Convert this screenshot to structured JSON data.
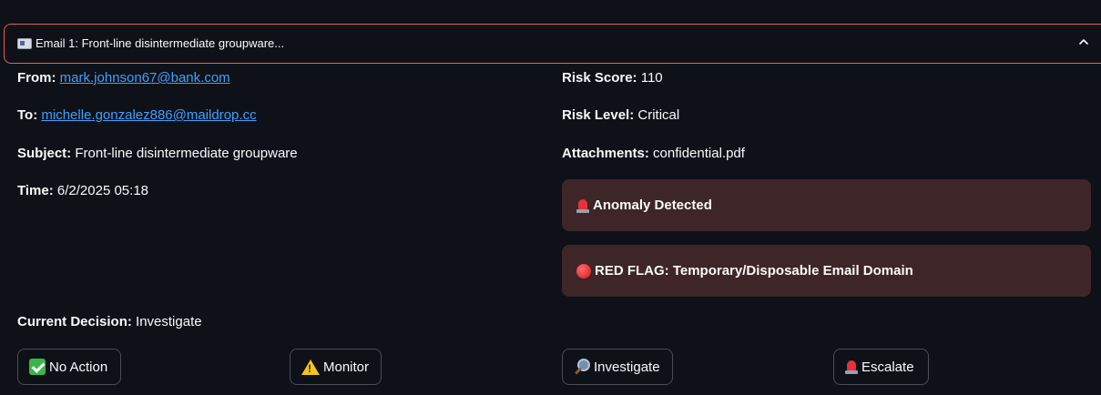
{
  "expander": {
    "title": "Email 1: Front-line disintermediate groupware...",
    "icon": "email-icon",
    "toggle_icon": "chevron-up-icon",
    "border_color": "#f05a5a"
  },
  "email": {
    "from_label": "From:",
    "from_value": "mark.johnson67@bank.com",
    "to_label": "To:",
    "to_value": "michelle.gonzalez886@maildrop.cc",
    "subject_label": "Subject:",
    "subject_value": "Front-line disintermediate groupware",
    "time_label": "Time:",
    "time_value": "6/2/2025 05:18"
  },
  "risk": {
    "score_label": "Risk Score:",
    "score_value": "110",
    "level_label": "Risk Level:",
    "level_value": "Critical",
    "attachments_label": "Attachments:",
    "attachments_value": "confidential.pdf"
  },
  "alerts": [
    {
      "icon": "siren-icon",
      "text": "Anomaly Detected"
    },
    {
      "icon": "red-circle-icon",
      "text": "RED FLAG: Temporary/Disposable Email Domain"
    }
  ],
  "decision": {
    "label": "Current Decision:",
    "value": "Investigate"
  },
  "buttons": {
    "no_action": {
      "icon": "check-mark-icon",
      "label": "No Action"
    },
    "monitor": {
      "icon": "warning-icon",
      "label": "Monitor"
    },
    "investigate": {
      "icon": "magnifying-glass-icon",
      "label": "Investigate"
    },
    "escalate": {
      "icon": "siren-icon",
      "label": "Escalate"
    }
  },
  "colors": {
    "background": "#0e1117",
    "link": "#3ea0ff",
    "alert_bg": "#3e2528"
  }
}
